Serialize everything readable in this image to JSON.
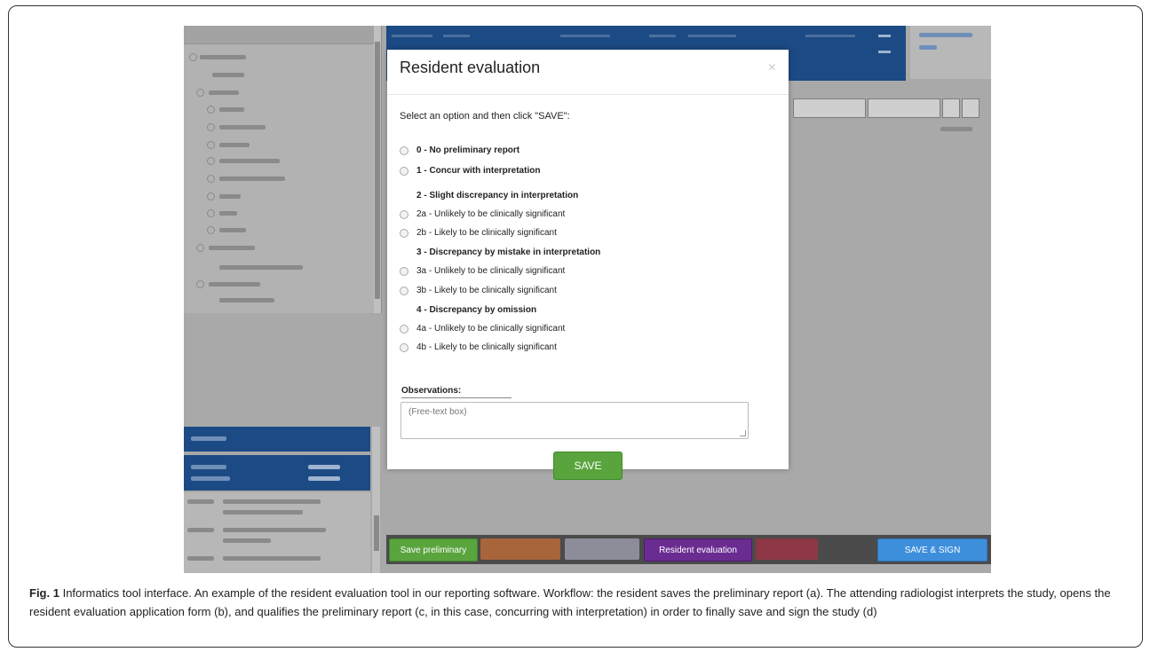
{
  "modal": {
    "title": "Resident evaluation",
    "close_glyph": "×",
    "instruction": "Select an option and then click \"SAVE\":",
    "options_top": [
      {
        "label": "0 - No preliminary report"
      },
      {
        "label": "1 - Concur with interpretation"
      }
    ],
    "group2": {
      "title": "2 - Slight discrepancy in interpretation",
      "options": [
        "2a - Unlikely to be clinically significant",
        "2b - Likely to be clinically significant"
      ]
    },
    "group3": {
      "title": "3 - Discrepancy by mistake in interpretation",
      "options": [
        "3a - Unlikely to be clinically significant",
        "3b - Likely to be clinically significant"
      ]
    },
    "group4": {
      "title": "4 - Discrepancy by omission",
      "options": [
        "4a - Unlikely to be clinically significant",
        "4b - Likely to be clinically significant"
      ]
    },
    "observations_label": "Observations:",
    "observations_placeholder": "(Free-text box)",
    "save_label": "SAVE"
  },
  "bottom_bar": {
    "save_preliminary": "Save preliminary",
    "resident_evaluation": "Resident evaluation",
    "save_and_sign": "SAVE & SIGN"
  },
  "colors": {
    "header_blue": "#1c4a84",
    "save_green": "#5aa43d",
    "resident_purple": "#6a2c91",
    "sign_blue": "#3d8fdc"
  },
  "caption": {
    "fig_label": "Fig. 1",
    "text": "Informatics tool interface. An example of the resident evaluation tool in our reporting software. Workflow: the resident saves the preliminary report (a). The attending radiologist interprets the study, opens the resident evaluation application form (b), and qualifies the preliminary report (c, in this case, concurring with interpretation) in order to finally save and sign the study (d)"
  }
}
